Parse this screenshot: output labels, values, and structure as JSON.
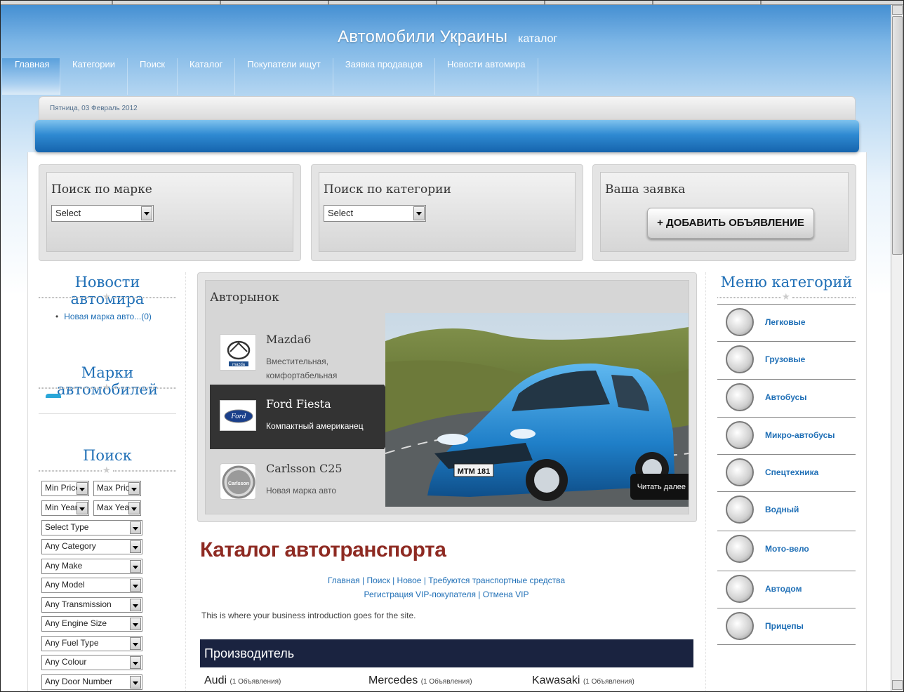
{
  "header": {
    "title": "Автомобили Украины",
    "subtitle": "каталог"
  },
  "nav": [
    "Главная",
    "Категории",
    "Поиск",
    "Каталог",
    "Покупатели ищут",
    "Заявка продавцов",
    "Новости автомира"
  ],
  "date": "Пятница, 03 Февраль 2012",
  "search_boxes": {
    "brand": {
      "title": "Поиск по марке",
      "select": "Select"
    },
    "category": {
      "title": "Поиск по категории",
      "select": "Select"
    },
    "request": {
      "title": "Ваша заявка",
      "button": "+ ДОБАВИТЬ ОБЪЯВЛЕНИЕ"
    }
  },
  "left": {
    "news_title": "Новости автомира",
    "news_item": "Новая марка авто...(0)",
    "brands_title": "Марки автомобилей",
    "search_title": "Поиск",
    "min_price": "Min Price",
    "max_price": "Max Price",
    "min_year": "Min Year",
    "max_year": "Max Year",
    "filters": [
      "Select Type",
      "Any Category",
      "Any Make",
      "Any Model",
      "Any Transmission",
      "Any Engine Size",
      "Any Fuel Type",
      "Any Colour",
      "Any Door Number"
    ]
  },
  "showcase": {
    "title": "Авторынок",
    "cars": [
      {
        "name": "Mazda6",
        "desc": "Вместительная, комфортабельная",
        "logo": "mazda"
      },
      {
        "name": "Ford Fiesta",
        "desc": "Компактный американец",
        "logo": "Ford"
      },
      {
        "name": "Carlsson C25",
        "desc": "Новая марка авто",
        "logo": "Carlsson"
      }
    ],
    "plate": "MTM 181",
    "read_more": "Читать далее"
  },
  "catalog": {
    "title": "Каталог автотранспорта",
    "links1": [
      "Главная",
      "Поиск",
      "Новое",
      "Требуются транспортные средства"
    ],
    "links2": [
      "Регистрация VIP-покупателя",
      "Отмена VIP"
    ],
    "intro": "This is where your business introduction goes for the site.",
    "makers_title": "Производитель",
    "makers": [
      {
        "name": "Audi",
        "count": "(1 Объявления)"
      },
      {
        "name": "Mercedes",
        "count": "(1 Объявления)"
      },
      {
        "name": "Kawasaki",
        "count": "(1 Объявления)"
      }
    ]
  },
  "right": {
    "title": "Меню категорий",
    "categories": [
      "Легковые",
      "Грузовые",
      "Автобусы",
      "Микро-автобусы",
      "Спецтехника",
      "Водный",
      "Мото-вело",
      "Автодом",
      "Прицепы"
    ]
  }
}
